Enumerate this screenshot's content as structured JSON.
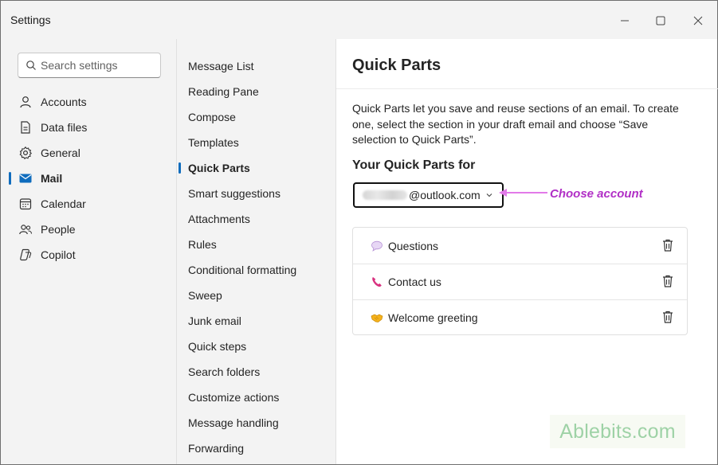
{
  "window": {
    "title": "Settings"
  },
  "window_controls": {
    "minimize_icon": "minimize-icon",
    "maximize_icon": "maximize-icon",
    "close_icon": "close-icon"
  },
  "search": {
    "placeholder": "Search settings",
    "value": ""
  },
  "nav": {
    "items": [
      {
        "label": "Accounts",
        "icon": "person-icon"
      },
      {
        "label": "Data files",
        "icon": "document-icon"
      },
      {
        "label": "General",
        "icon": "gear-icon"
      },
      {
        "label": "Mail",
        "icon": "mail-icon",
        "active": true
      },
      {
        "label": "Calendar",
        "icon": "calendar-icon"
      },
      {
        "label": "People",
        "icon": "people-icon"
      },
      {
        "label": "Copilot",
        "icon": "copilot-icon"
      }
    ]
  },
  "mail_sections": {
    "items": [
      "Message List",
      "Reading Pane",
      "Compose",
      "Templates",
      "Quick Parts",
      "Smart suggestions",
      "Attachments",
      "Rules",
      "Conditional formatting",
      "Sweep",
      "Junk email",
      "Quick steps",
      "Search folders",
      "Customize actions",
      "Message handling",
      "Forwarding"
    ],
    "active_index": 4
  },
  "content": {
    "title": "Quick Parts",
    "description": "Quick Parts let you save and reuse sections of an email. To create one, select the section in your draft email and choose “Save selection to Quick Parts”.",
    "subtitle": "Your Quick Parts for",
    "account_domain": "@outlook.com",
    "callout": "Choose account",
    "quick_parts": [
      {
        "name": "Questions",
        "icon": "speech-bubble-icon"
      },
      {
        "name": "Contact us",
        "icon": "phone-icon"
      },
      {
        "name": "Welcome greeting",
        "icon": "handshake-icon"
      }
    ]
  },
  "watermark": {
    "brand": "Ablebits",
    "suffix": ".com"
  },
  "colors": {
    "accent": "#0f6cbd",
    "callout": "#b12fc6",
    "watermark": "#9ed2a6"
  }
}
